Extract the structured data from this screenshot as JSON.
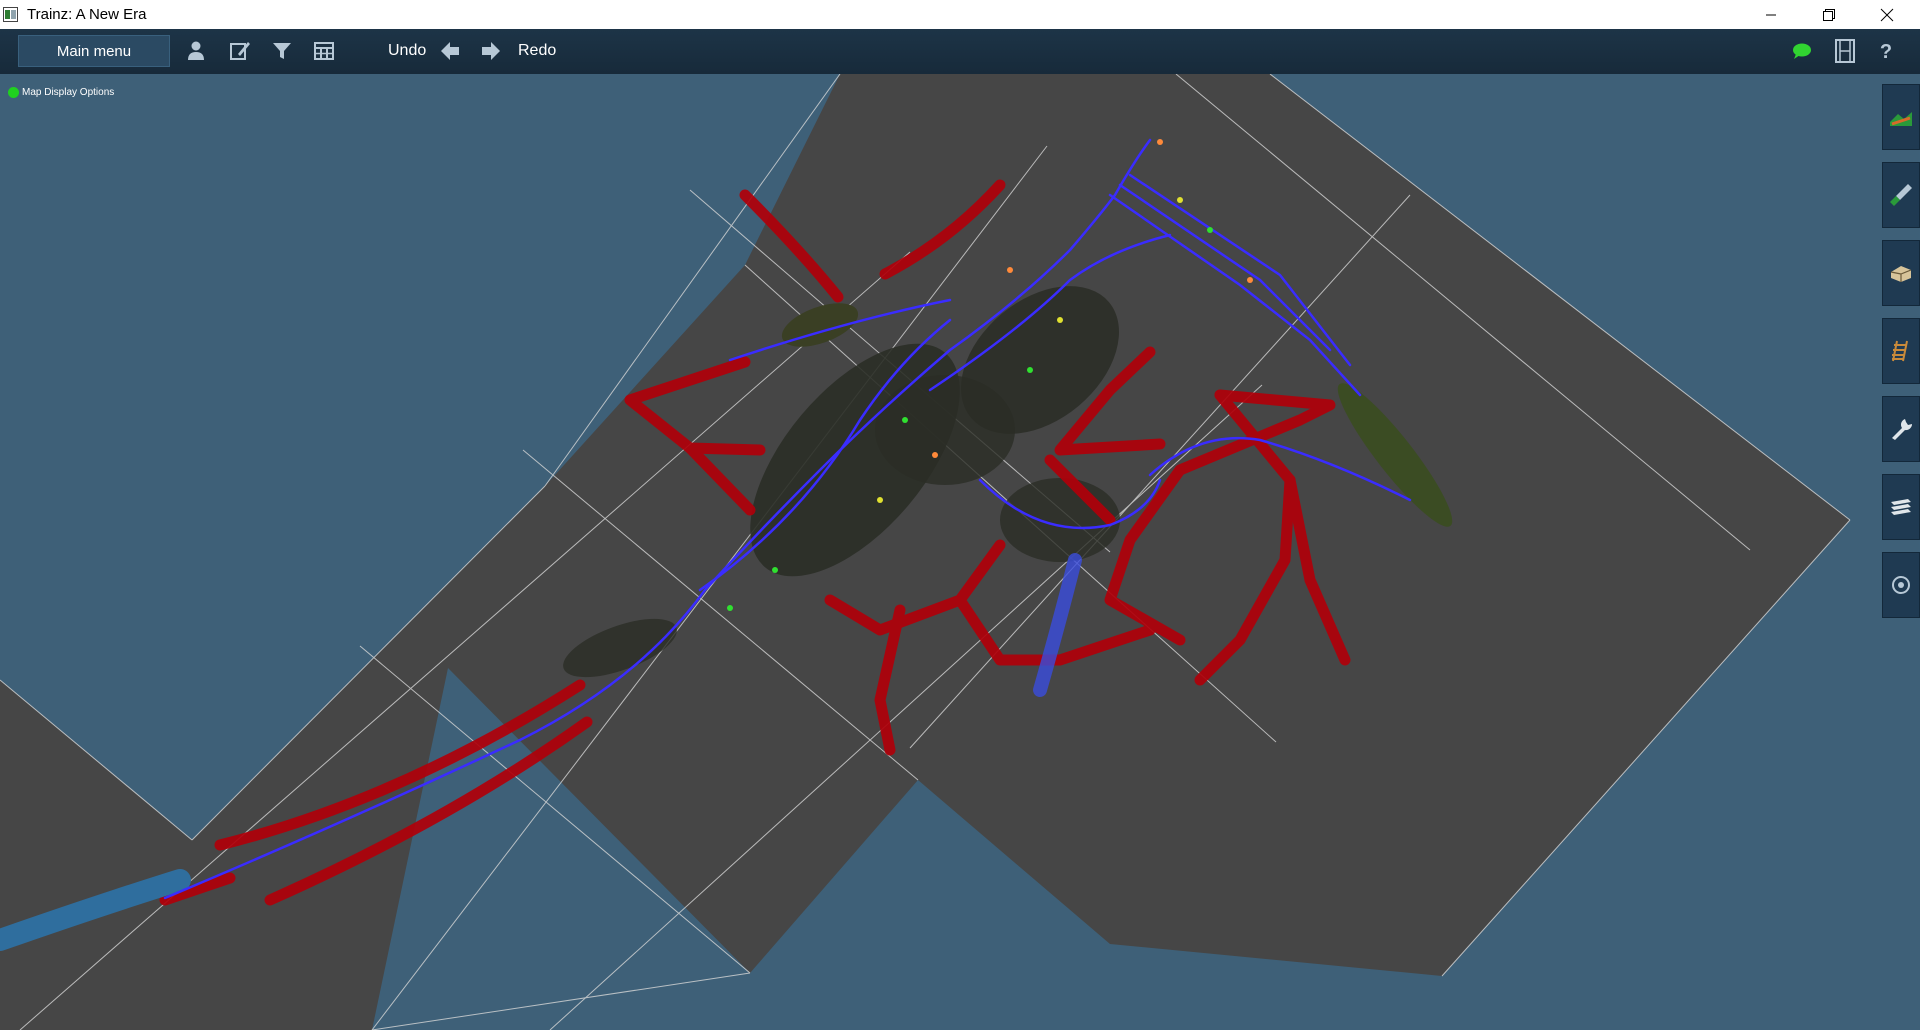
{
  "window": {
    "title": "Trainz: A New Era"
  },
  "toolbar": {
    "main_menu_label": "Main menu",
    "undo_label": "Undo",
    "redo_label": "Redo"
  },
  "map": {
    "display_options_label": "Map Display Options"
  },
  "icons": {
    "toolbar_left": [
      "driver-icon",
      "edit-icon",
      "filter-icon",
      "grid-icon",
      "undo-arrow-icon",
      "redo-arrow-icon"
    ],
    "toolbar_right": [
      "chat-bubble-icon",
      "filmstrip-icon",
      "help-icon"
    ],
    "side_tools": [
      "terrain-tool-icon",
      "paint-tool-icon",
      "objects-tool-icon",
      "track-tool-icon",
      "tools-wrench-icon",
      "layers-icon",
      "settings-icon"
    ]
  },
  "colors": {
    "background": "#3e6078",
    "toolbar": "#1b3143",
    "tile": "#464646",
    "road": "#b0000a",
    "track": "#3a2cff",
    "water": "#2f6e9e"
  }
}
